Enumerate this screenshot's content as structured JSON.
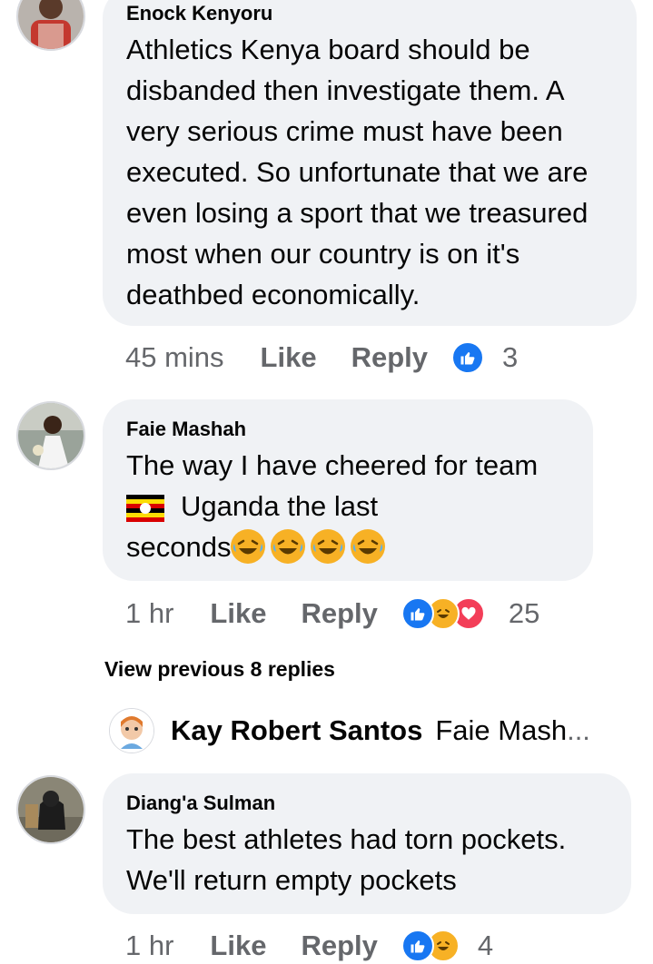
{
  "comments": [
    {
      "author": "Enock Kenyoru",
      "text": "Athletics Kenya board should be disbanded then investigate them. A very serious crime must have been executed. So unfortunate that we are even losing a sport that we treasured most when our country is on it's deathbed economically.",
      "time": "45 mins",
      "like_label": "Like",
      "reply_label": "Reply",
      "reactions": [
        "like-icon"
      ],
      "reaction_count": "3"
    },
    {
      "author": "Faie Mashah",
      "text_line1": "The way I have cheered for team",
      "text_line2": "Uganda the last",
      "text_line3": "seconds",
      "flag": "uganda-flag",
      "emoji": "laughing-crying-emoji",
      "emoji_count": 4,
      "time": "1 hr",
      "like_label": "Like",
      "reply_label": "Reply",
      "reactions": [
        "like-icon",
        "haha-icon",
        "love-icon"
      ],
      "reaction_count": "25"
    },
    {
      "author": "Diang'a Sulman",
      "text": "The best athletes had torn pockets. We'll return empty pockets",
      "time": "1 hr",
      "like_label": "Like",
      "reply_label": "Reply",
      "reactions": [
        "like-icon",
        "haha-icon"
      ],
      "reaction_count": "4"
    }
  ],
  "view_previous": "View previous 8 replies",
  "latest_reply": {
    "author": "Kay Robert Santos",
    "text": "Faie Mash",
    "ellipsis": "..."
  },
  "colors": {
    "bubble": "#f0f2f5",
    "meta": "#65676b",
    "like_blue": "#1877f2",
    "haha_yellow": "#f7b125",
    "love_red": "#f33e58"
  }
}
